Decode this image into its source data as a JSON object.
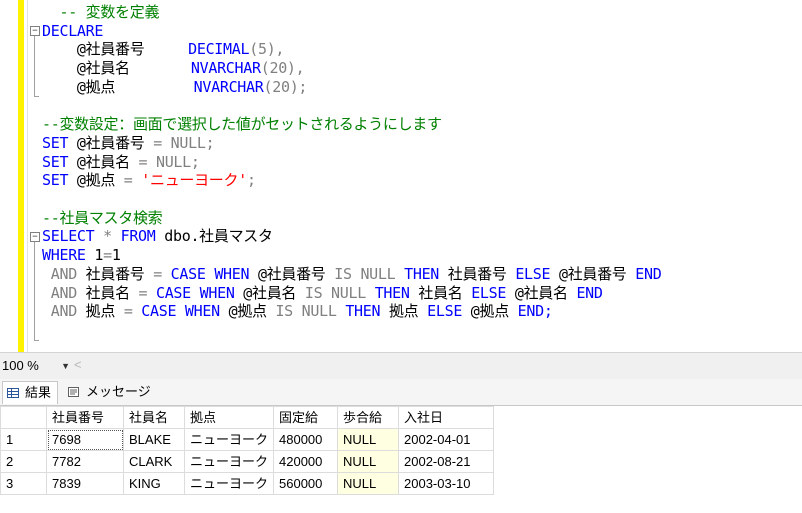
{
  "editor": {
    "lines": [
      [
        {
          "t": "  -- 変数を定義",
          "c": "cm"
        }
      ],
      [
        {
          "t": "DECLARE",
          "c": "kw"
        }
      ],
      [
        {
          "t": "    @社員番号     ",
          "c": ""
        },
        {
          "t": "DECIMAL",
          "c": "kw"
        },
        {
          "t": "(5),",
          "c": "gr"
        }
      ],
      [
        {
          "t": "    @社員名       ",
          "c": ""
        },
        {
          "t": "NVARCHAR",
          "c": "kw"
        },
        {
          "t": "(20),",
          "c": "gr"
        }
      ],
      [
        {
          "t": "    @拠点         ",
          "c": ""
        },
        {
          "t": "NVARCHAR",
          "c": "kw"
        },
        {
          "t": "(20);",
          "c": "gr"
        }
      ],
      [
        {
          "t": "",
          "c": ""
        }
      ],
      [
        {
          "t": "--変数設定：画面で選択した値がセットされるようにします",
          "c": "cm"
        }
      ],
      [
        {
          "t": "SET",
          "c": "kw"
        },
        {
          "t": " @社員番号 ",
          "c": ""
        },
        {
          "t": "=",
          "c": "gr"
        },
        {
          "t": " ",
          "c": ""
        },
        {
          "t": "NULL;",
          "c": "gr"
        }
      ],
      [
        {
          "t": "SET",
          "c": "kw"
        },
        {
          "t": " @社員名 ",
          "c": ""
        },
        {
          "t": "=",
          "c": "gr"
        },
        {
          "t": " ",
          "c": ""
        },
        {
          "t": "NULL;",
          "c": "gr"
        }
      ],
      [
        {
          "t": "SET",
          "c": "kw"
        },
        {
          "t": " @拠点 ",
          "c": ""
        },
        {
          "t": "=",
          "c": "gr"
        },
        {
          "t": " ",
          "c": ""
        },
        {
          "t": "'ニューヨーク'",
          "c": "st"
        },
        {
          "t": ";",
          "c": "gr"
        }
      ],
      [
        {
          "t": "",
          "c": ""
        }
      ],
      [
        {
          "t": "--社員マスタ検索",
          "c": "cm"
        }
      ],
      [
        {
          "t": "SELECT",
          "c": "kw"
        },
        {
          "t": " * ",
          "c": "gr"
        },
        {
          "t": "FROM",
          "c": "kw"
        },
        {
          "t": " dbo.社員マスタ",
          "c": ""
        }
      ],
      [
        {
          "t": "WHERE",
          "c": "kw"
        },
        {
          "t": " 1",
          "c": ""
        },
        {
          "t": "=",
          "c": "gr"
        },
        {
          "t": "1",
          "c": ""
        }
      ],
      [
        {
          "t": " ",
          "c": ""
        },
        {
          "t": "AND",
          "c": "gr"
        },
        {
          "t": " 社員番号 ",
          "c": ""
        },
        {
          "t": "=",
          "c": "gr"
        },
        {
          "t": " ",
          "c": ""
        },
        {
          "t": "CASE WHEN",
          "c": "kw"
        },
        {
          "t": " @社員番号 ",
          "c": ""
        },
        {
          "t": "IS NULL",
          "c": "gr"
        },
        {
          "t": " ",
          "c": ""
        },
        {
          "t": "THEN",
          "c": "kw"
        },
        {
          "t": " 社員番号 ",
          "c": ""
        },
        {
          "t": "ELSE",
          "c": "kw"
        },
        {
          "t": " @社員番号 ",
          "c": ""
        },
        {
          "t": "END",
          "c": "kw"
        }
      ],
      [
        {
          "t": " ",
          "c": ""
        },
        {
          "t": "AND",
          "c": "gr"
        },
        {
          "t": " 社員名 ",
          "c": ""
        },
        {
          "t": "=",
          "c": "gr"
        },
        {
          "t": " ",
          "c": ""
        },
        {
          "t": "CASE WHEN",
          "c": "kw"
        },
        {
          "t": " @社員名 ",
          "c": ""
        },
        {
          "t": "IS NULL",
          "c": "gr"
        },
        {
          "t": " ",
          "c": ""
        },
        {
          "t": "THEN",
          "c": "kw"
        },
        {
          "t": " 社員名 ",
          "c": ""
        },
        {
          "t": "ELSE",
          "c": "kw"
        },
        {
          "t": " @社員名 ",
          "c": ""
        },
        {
          "t": "END",
          "c": "kw"
        }
      ],
      [
        {
          "t": " ",
          "c": ""
        },
        {
          "t": "AND",
          "c": "gr"
        },
        {
          "t": " 拠点 ",
          "c": ""
        },
        {
          "t": "=",
          "c": "gr"
        },
        {
          "t": " ",
          "c": ""
        },
        {
          "t": "CASE WHEN",
          "c": "kw"
        },
        {
          "t": " @拠点 ",
          "c": ""
        },
        {
          "t": "IS NULL",
          "c": "gr"
        },
        {
          "t": " ",
          "c": ""
        },
        {
          "t": "THEN",
          "c": "kw"
        },
        {
          "t": " 拠点 ",
          "c": ""
        },
        {
          "t": "ELSE",
          "c": "kw"
        },
        {
          "t": " @拠点 ",
          "c": ""
        },
        {
          "t": "END;",
          "c": "kw"
        }
      ]
    ]
  },
  "statusbar": {
    "zoom": "100 %"
  },
  "tabs": {
    "results_label": "結果",
    "messages_label": "メッセージ"
  },
  "results": {
    "columns": [
      "社員番号",
      "社員名",
      "拠点",
      "固定給",
      "歩合給",
      "入社日"
    ],
    "rows": [
      {
        "num": "1",
        "cells": [
          "7698",
          "BLAKE",
          "ニューヨーク",
          "480000",
          "NULL",
          "2002-04-01"
        ]
      },
      {
        "num": "2",
        "cells": [
          "7782",
          "CLARK",
          "ニューヨーク",
          "420000",
          "NULL",
          "2002-08-21"
        ]
      },
      {
        "num": "3",
        "cells": [
          "7839",
          "KING",
          "ニューヨーク",
          "560000",
          "NULL",
          "2003-03-10"
        ]
      }
    ]
  }
}
